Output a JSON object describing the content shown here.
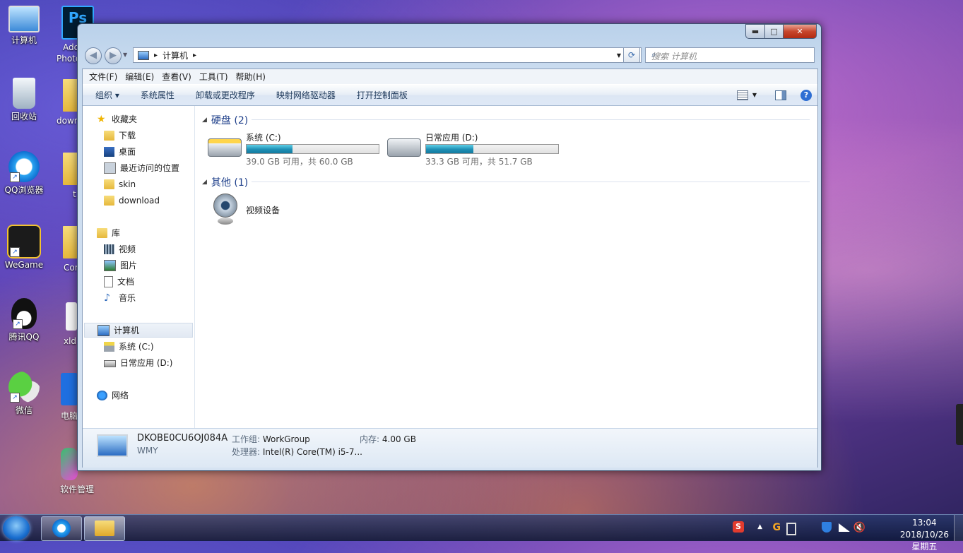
{
  "desktop": {
    "icons": [
      {
        "label": "计算机"
      },
      {
        "label": "回收站"
      },
      {
        "label": "QQ浏览器"
      },
      {
        "label": "WeGame"
      },
      {
        "label": "腾讯QQ"
      },
      {
        "label": "微信"
      }
    ],
    "partial": {
      "ps_top": "Ps",
      "ps_line1": "Ado",
      "ps_line2": "Photo",
      "item2": "dowr",
      "item3": "t",
      "item4": "Cor",
      "item5": "xld",
      "item6": "电脑",
      "item7": "软件管理"
    }
  },
  "window": {
    "caption": {
      "min": "▬",
      "max": "□",
      "close": "✕"
    },
    "nav": {
      "back": "◀",
      "forward": "▶",
      "breadcrumb": "计算机",
      "sep": "▸",
      "dropdown": "▼",
      "refresh": "⟳"
    },
    "search": {
      "placeholder": "搜索 计算机",
      "icon": "⌕"
    },
    "menu": [
      "文件(F)",
      "编辑(E)",
      "查看(V)",
      "工具(T)",
      "帮助(H)"
    ],
    "toolbar": {
      "organize": "组织 ▾",
      "items": [
        "系统属性",
        "卸载或更改程序",
        "映射网络驱动器",
        "打开控制面板"
      ],
      "help": "?"
    },
    "navpane": {
      "favorites": "收藏夹",
      "fav_items": [
        "下载",
        "桌面",
        "最近访问的位置",
        "skin",
        "download"
      ],
      "libraries": "库",
      "lib_items": [
        "视频",
        "图片",
        "文档",
        "音乐"
      ],
      "computer": "计算机",
      "comp_items": [
        "系统 (C:)",
        "日常应用 (D:)"
      ],
      "network": "网络"
    },
    "content": {
      "group_hdd": "硬盘 (2)",
      "drives": [
        {
          "name": "系统 (C:)",
          "free": "39.0 GB 可用，共 60.0 GB",
          "used_fraction": 0.35
        },
        {
          "name": "日常应用 (D:)",
          "free": "33.3 GB 可用，共 51.7 GB",
          "used_fraction": 0.356
        }
      ],
      "group_other": "其他 (1)",
      "other_item": "视频设备"
    },
    "details": {
      "computer_name": "DKOBE0CU6OJ084A",
      "user": "WMY",
      "workgroup_label": "工作组:",
      "workgroup": "WorkGroup",
      "memory_label": "内存:",
      "memory": "4.00 GB",
      "cpu_label": "处理器:",
      "cpu": "Intel(R) Core(TM) i5-7..."
    }
  },
  "taskbar": {
    "time": "13:04",
    "date": "2018/10/26 星期五",
    "tray_arrow": "▲"
  },
  "colors": {
    "accent": "#1e3f8a",
    "bar_fill": "#1e8fb4"
  }
}
